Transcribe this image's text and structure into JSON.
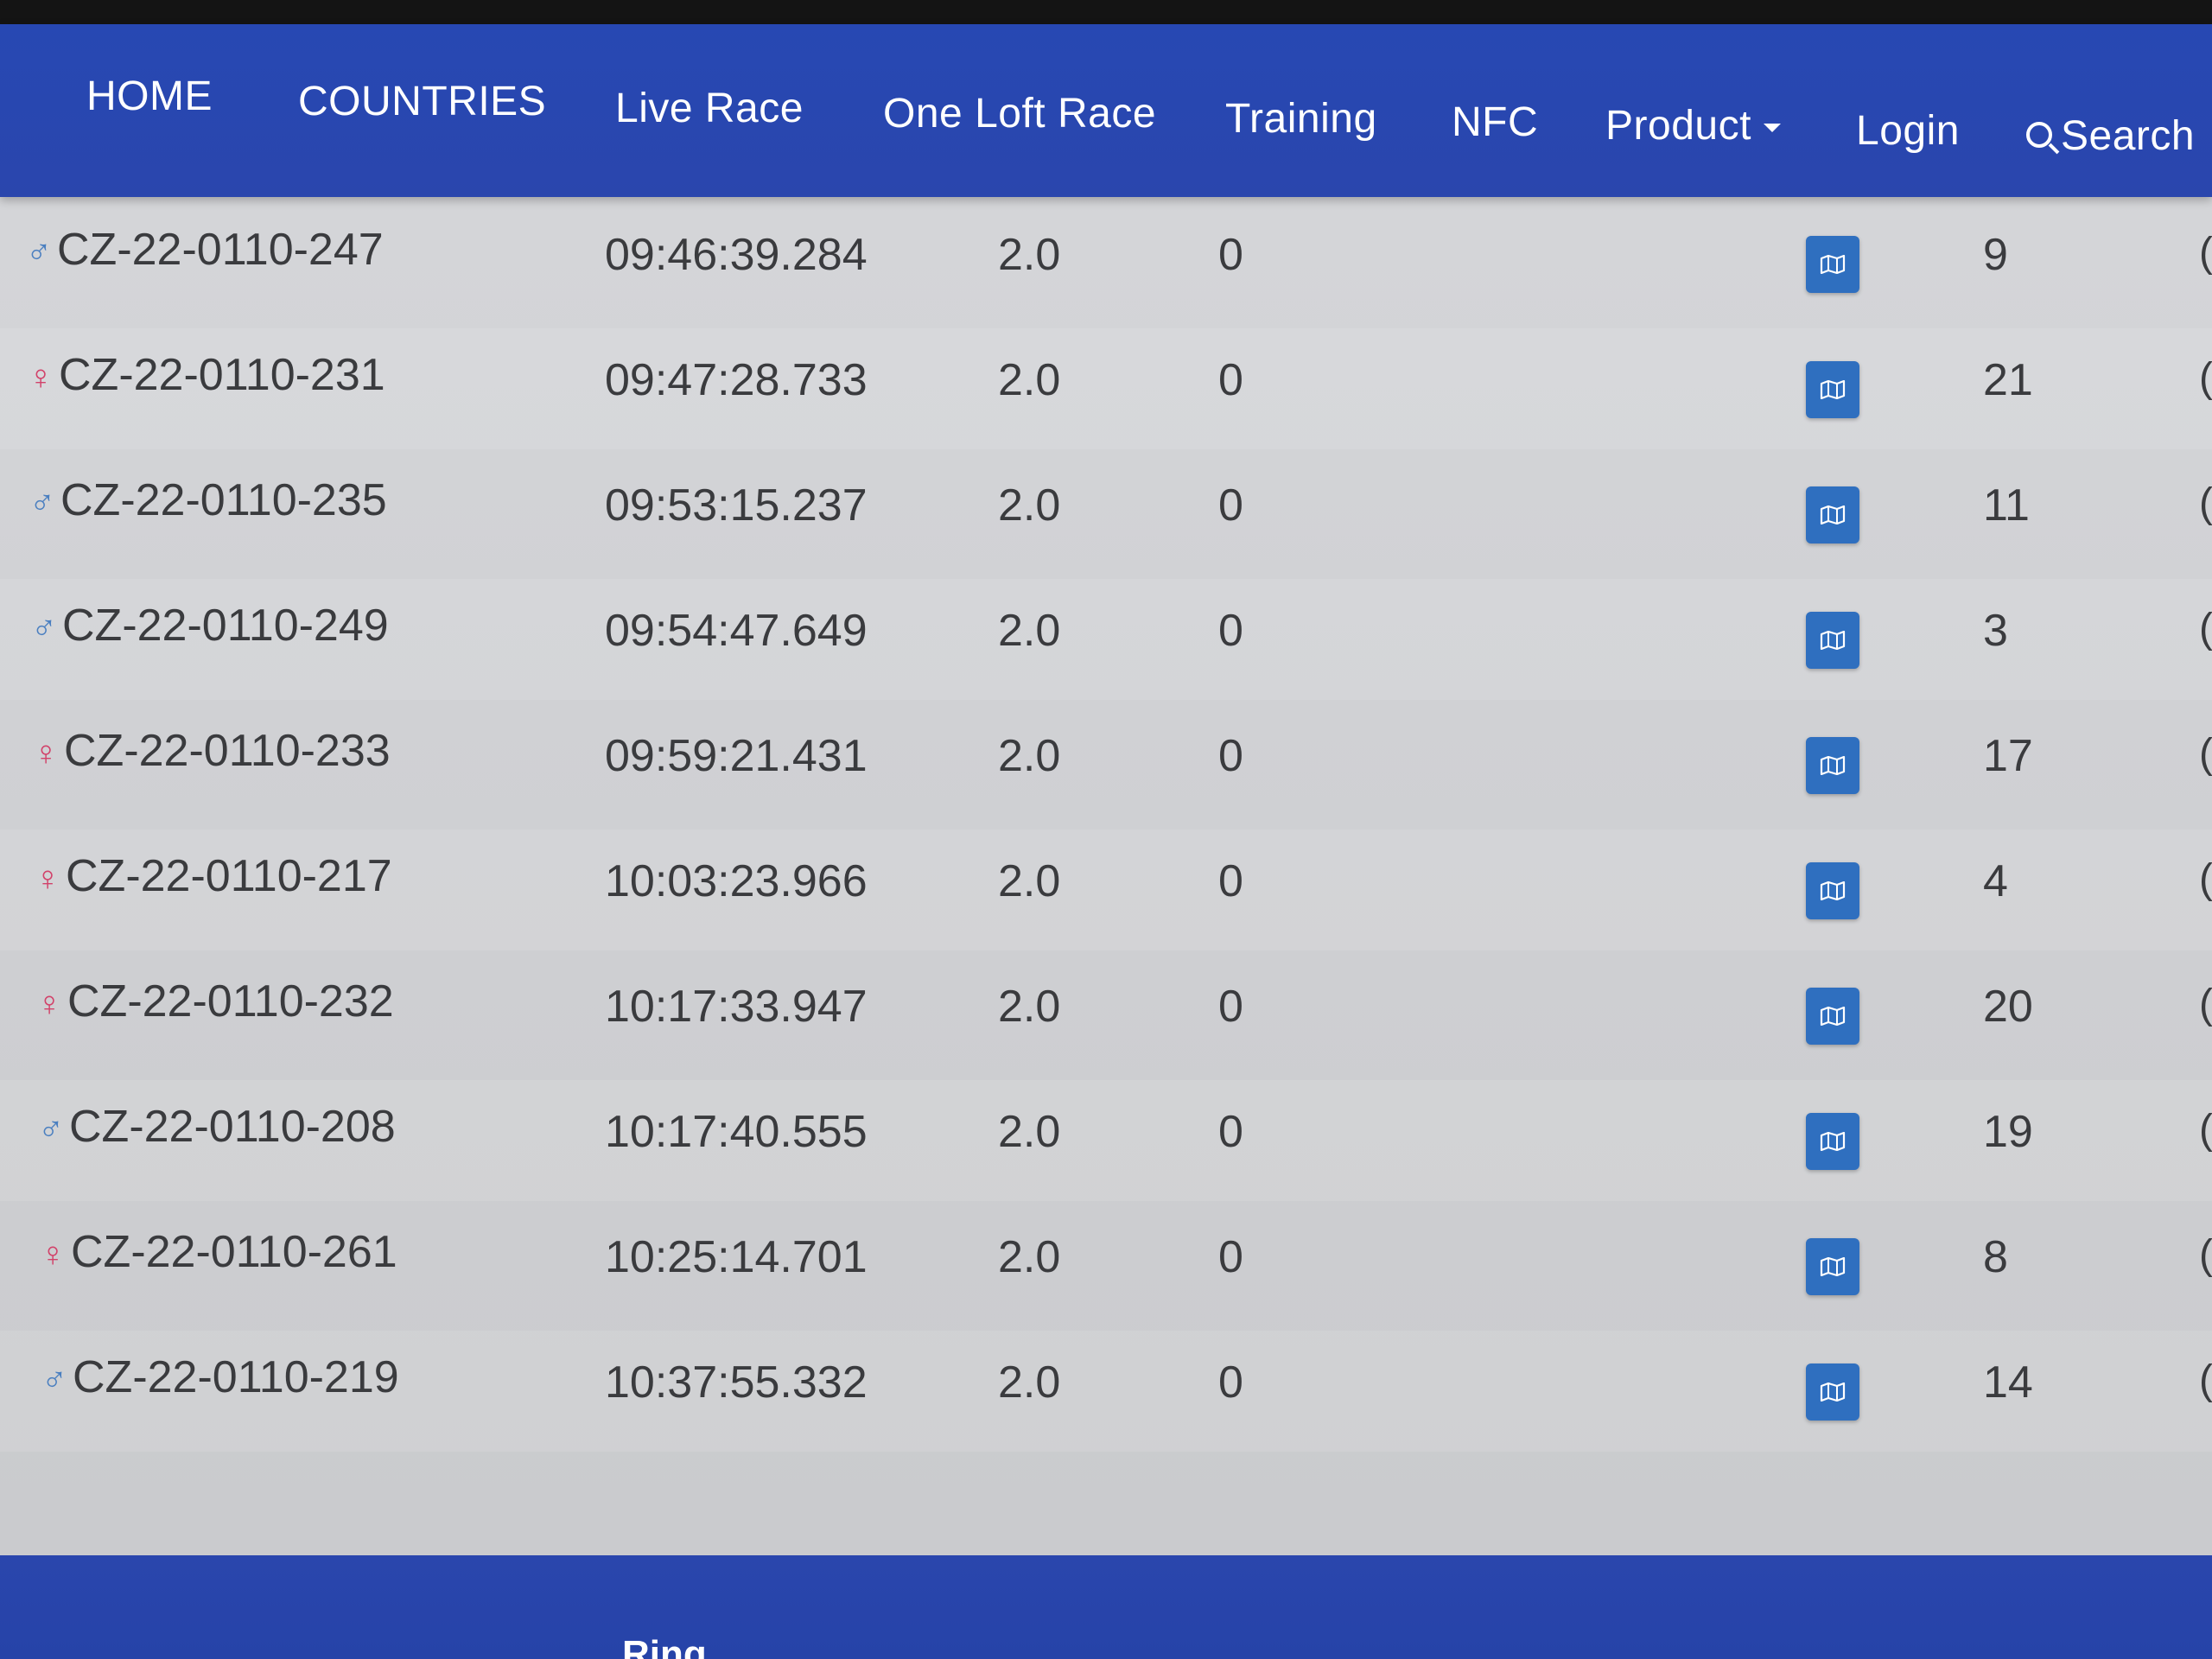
{
  "nav": {
    "items": [
      {
        "id": "home",
        "label": "HOME"
      },
      {
        "id": "countries",
        "label": "COUNTRIES"
      },
      {
        "id": "live-race",
        "label": "Live Race"
      },
      {
        "id": "one-loft-race",
        "label": "One Loft Race"
      },
      {
        "id": "training",
        "label": "Training"
      },
      {
        "id": "nfc",
        "label": "NFC"
      },
      {
        "id": "product",
        "label": "Product",
        "dropdown": true
      },
      {
        "id": "login",
        "label": "Login"
      }
    ],
    "search_label": "Search"
  },
  "table": {
    "rows": [
      {
        "sex": "male",
        "ring": "CZ-22-0110-247",
        "time": "09:46:39.284",
        "value": "2.0",
        "count": "0",
        "rank": "9"
      },
      {
        "sex": "female",
        "ring": "CZ-22-0110-231",
        "time": "09:47:28.733",
        "value": "2.0",
        "count": "0",
        "rank": "21"
      },
      {
        "sex": "male",
        "ring": "CZ-22-0110-235",
        "time": "09:53:15.237",
        "value": "2.0",
        "count": "0",
        "rank": "11"
      },
      {
        "sex": "male",
        "ring": "CZ-22-0110-249",
        "time": "09:54:47.649",
        "value": "2.0",
        "count": "0",
        "rank": "3"
      },
      {
        "sex": "female",
        "ring": "CZ-22-0110-233",
        "time": "09:59:21.431",
        "value": "2.0",
        "count": "0",
        "rank": "17"
      },
      {
        "sex": "female",
        "ring": "CZ-22-0110-217",
        "time": "10:03:23.966",
        "value": "2.0",
        "count": "0",
        "rank": "4"
      },
      {
        "sex": "female",
        "ring": "CZ-22-0110-232",
        "time": "10:17:33.947",
        "value": "2.0",
        "count": "0",
        "rank": "20"
      },
      {
        "sex": "male",
        "ring": "CZ-22-0110-208",
        "time": "10:17:40.555",
        "value": "2.0",
        "count": "0",
        "rank": "19"
      },
      {
        "sex": "female",
        "ring": "CZ-22-0110-261",
        "time": "10:25:14.701",
        "value": "2.0",
        "count": "0",
        "rank": "8"
      },
      {
        "sex": "male",
        "ring": "CZ-22-0110-219",
        "time": "10:37:55.332",
        "value": "2.0",
        "count": "0",
        "rank": "14"
      }
    ]
  },
  "icons": {
    "male": "male-symbol-icon",
    "female": "female-symbol-icon",
    "map": "map-icon"
  },
  "footer": {
    "partial_text": "Ring"
  },
  "colors": {
    "navbar": "#2748b3",
    "map_button": "#2f6fbf",
    "male": "#4a7fc0",
    "female": "#d2426a",
    "text": "#3a3b3e"
  }
}
